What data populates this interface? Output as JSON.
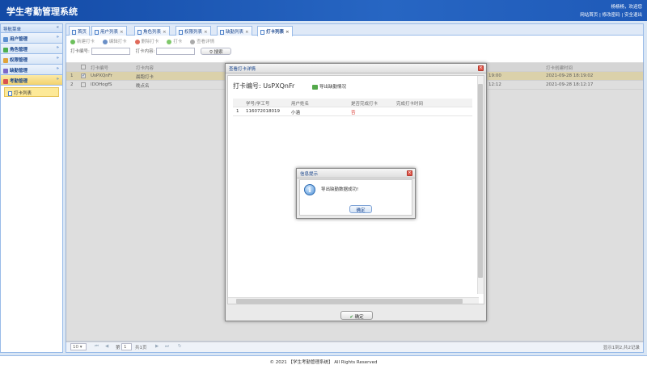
{
  "app": {
    "title": "学生考勤管理系统",
    "user_greeting": "杨杨杨，欢迎您",
    "links": "网站首页 | 修改密码 | 安全退出",
    "footer": "© 2021 【学生考勤管理系统】 All Rights Reserved"
  },
  "sidebar": {
    "header": "导航菜单",
    "collapse_icon": "«",
    "menus": [
      {
        "label": "用户管理",
        "arrow": "»"
      },
      {
        "label": "角色管理",
        "arrow": "»"
      },
      {
        "label": "权限管理",
        "arrow": "»"
      },
      {
        "label": "缺勤管理",
        "arrow": "»"
      },
      {
        "label": "考勤管理",
        "arrow": "»"
      }
    ],
    "subitem": "打卡列表"
  },
  "tabs": [
    {
      "label": "首页"
    },
    {
      "label": "用户列表"
    },
    {
      "label": "角色列表"
    },
    {
      "label": "权限列表"
    },
    {
      "label": "缺勤列表"
    },
    {
      "label": "打卡列表"
    }
  ],
  "tab_close": "×",
  "toolbar": {
    "new": "新建打卡",
    "edit": "编辑打卡",
    "delete": "删除打卡",
    "clock": "打卡",
    "view": "查看详情"
  },
  "search": {
    "no_label": "打卡编号:",
    "content_label": "打卡内容:",
    "button": "搜索"
  },
  "grid": {
    "headers": {
      "no": "打卡编号",
      "content": "打卡内容",
      "time": "打卡创建时间"
    },
    "rows": [
      {
        "index": "1",
        "no": "UsPXQnFr",
        "content": "晨跑打卡",
        "partial_time": "19:00",
        "create_time": "2021-09-28 18:19:02"
      },
      {
        "index": "2",
        "no": "lDOHogfS",
        "content": "晚点名",
        "partial_time": "12:12",
        "create_time": "2021-09-28 18:12:17"
      }
    ]
  },
  "pager": {
    "size": "10",
    "page": "1",
    "total_pages": "共1页",
    "info": "显示1到2,共2记录"
  },
  "dialog": {
    "title": "查看打卡详情",
    "clock_no_label": "打卡编号:",
    "clock_no": "UsPXQnFr",
    "export": "导出缺勤情况",
    "headers": {
      "idx": "",
      "student_no": "学号/学工号",
      "name": "用户姓名",
      "done": "是否完成打卡",
      "finish_time": "完成打卡时间"
    },
    "rows": [
      {
        "idx": "1",
        "student_no": "116072018019",
        "name": "小涵",
        "done": "否",
        "finish_time": ""
      }
    ],
    "ok": "确定",
    "close": "×"
  },
  "message": {
    "title": "信息提示",
    "text": "导出缺勤数据成功!",
    "ok": "确定",
    "icon": "i",
    "close": "×"
  },
  "colors": {
    "header_blue": "#1f5ab8",
    "selection_yellow": "#fbecb0",
    "no_red": "#d9342b"
  }
}
